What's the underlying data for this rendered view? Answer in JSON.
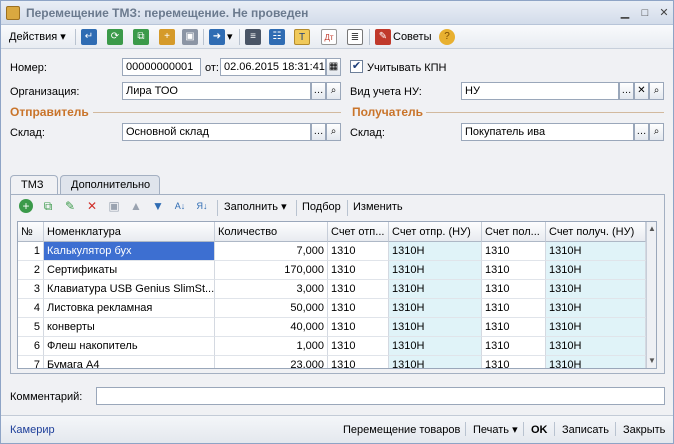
{
  "window": {
    "title": "Перемещение ТМЗ: перемещение. Не проведен"
  },
  "toolbar": {
    "actions_label": "Действия",
    "tips_label": "Советы"
  },
  "form": {
    "number_label": "Номер:",
    "number_value": "00000000001",
    "date_label": "от:",
    "date_value": "02.06.2015 18:31:41",
    "kpn_label": "Учитывать КПН",
    "kpn_checked": "✔",
    "org_label": "Организация:",
    "org_value": "Лира ТОО",
    "nu_label": "Вид учета НУ:",
    "nu_value": "НУ",
    "sender_section": "Отправитель",
    "receiver_section": "Получатель",
    "sender_wh_label": "Склад:",
    "sender_wh_value": "Основной склад",
    "receiver_wh_label": "Склад:",
    "receiver_wh_value": "Покупатель ива",
    "comment_label": "Комментарий:",
    "comment_value": ""
  },
  "tabs": [
    {
      "label": "ТМЗ"
    },
    {
      "label": "Дополнительно"
    }
  ],
  "inner_toolbar": {
    "fill_label": "Заполнить",
    "pick_label": "Подбор",
    "change_label": "Изменить"
  },
  "table": {
    "headers": [
      "№",
      "Номенклатура",
      "Количество",
      "Счет отп...",
      "Счет отпр. (НУ)",
      "Счет пол...",
      "Счет получ. (НУ)"
    ],
    "rows": [
      {
        "n": "1",
        "name": "Калькулятор бух",
        "qty": "7,000",
        "a": "1310",
        "b": "1310Н",
        "c": "1310",
        "d": "1310Н"
      },
      {
        "n": "2",
        "name": "Сертификаты",
        "qty": "170,000",
        "a": "1310",
        "b": "1310Н",
        "c": "1310",
        "d": "1310Н"
      },
      {
        "n": "3",
        "name": "Клавиатура USB Genius SlimSt...",
        "qty": "3,000",
        "a": "1310",
        "b": "1310Н",
        "c": "1310",
        "d": "1310Н"
      },
      {
        "n": "4",
        "name": "Листовка рекламная",
        "qty": "50,000",
        "a": "1310",
        "b": "1310Н",
        "c": "1310",
        "d": "1310Н"
      },
      {
        "n": "5",
        "name": "конверты",
        "qty": "40,000",
        "a": "1310",
        "b": "1310Н",
        "c": "1310",
        "d": "1310Н"
      },
      {
        "n": "6",
        "name": "Флеш накопитель",
        "qty": "1,000",
        "a": "1310",
        "b": "1310Н",
        "c": "1310",
        "d": "1310Н"
      },
      {
        "n": "7",
        "name": "Бумага А4",
        "qty": "23,000",
        "a": "1310",
        "b": "1310Н",
        "c": "1310",
        "d": "1310Н"
      }
    ]
  },
  "footer": {
    "kamerir": "Камерир",
    "move_goods": "Перемещение товаров",
    "print": "Печать",
    "ok": "OK",
    "save": "Записать",
    "close": "Закрыть"
  },
  "colors": {
    "accent": "#c9742a",
    "selected": "#3d6fd1",
    "nu_col": "#e0f3f8"
  }
}
